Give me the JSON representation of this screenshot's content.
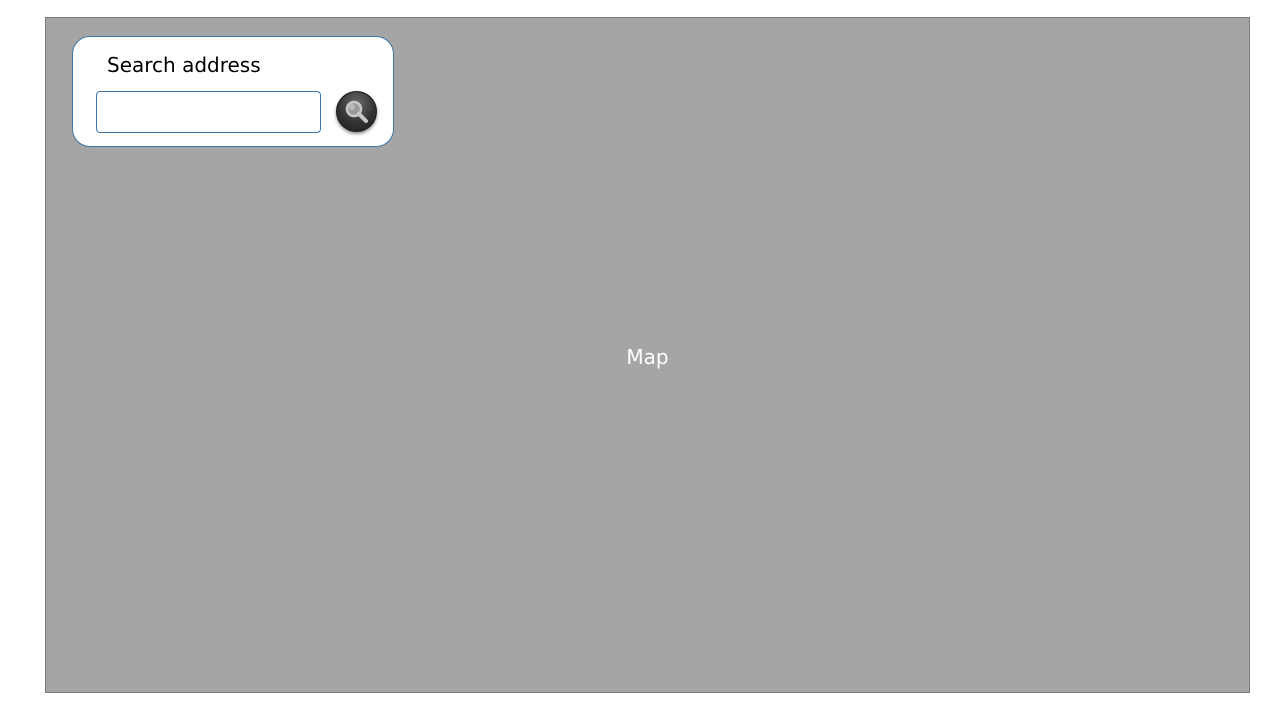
{
  "map": {
    "label": "Map",
    "background_color": "#a5a5a5"
  },
  "search": {
    "title": "Search address",
    "input_value": "",
    "placeholder": "",
    "button_icon": "magnifier-icon",
    "border_color": "#3c78a8"
  }
}
